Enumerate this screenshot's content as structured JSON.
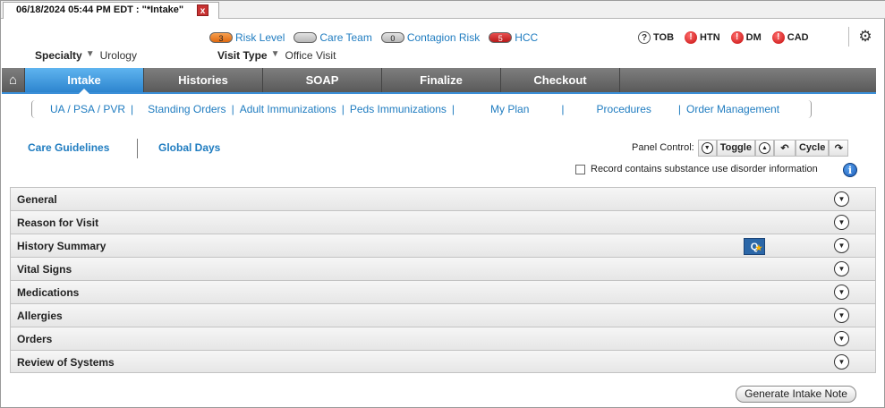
{
  "doc_tab": {
    "title": "06/18/2024 05:44 PM EDT : \"*Intake\"",
    "close": "x"
  },
  "badges": [
    {
      "count": "3",
      "label": "Risk Level",
      "style": "orange"
    },
    {
      "count": "",
      "label": "Care Team",
      "style": "gray"
    },
    {
      "count": "0",
      "label": "Contagion Risk",
      "style": "gray"
    },
    {
      "count": "5",
      "label": "HCC",
      "style": "red"
    }
  ],
  "indicators": [
    {
      "icon": "?",
      "label": "TOB",
      "kind": "question"
    },
    {
      "icon": "!",
      "label": "HTN",
      "kind": "alert"
    },
    {
      "icon": "!",
      "label": "DM",
      "kind": "alert"
    },
    {
      "icon": "!",
      "label": "CAD",
      "kind": "alert"
    }
  ],
  "meta": {
    "specialty_label": "Specialty",
    "specialty_value": "Urology",
    "visit_type_label": "Visit Type",
    "visit_type_value": "Office Visit",
    "caret": "▼"
  },
  "main_tabs": [
    "Intake",
    "Histories",
    "SOAP",
    "Finalize",
    "Checkout"
  ],
  "active_tab": "Intake",
  "subnav": [
    "UA / PSA / PVR",
    "Standing Orders",
    "Adult Immunizations",
    "Peds Immunizations",
    "My Plan",
    "Procedures",
    "Order Management"
  ],
  "guidelines": {
    "care_guidelines": "Care Guidelines",
    "global_days": "Global Days"
  },
  "panel_control": {
    "label": "Panel Control:",
    "toggle": "Toggle",
    "cycle": "Cycle"
  },
  "sud_checkbox": {
    "label": "Record contains substance use disorder information",
    "checked": false
  },
  "info_icon": "i",
  "panels": [
    "General",
    "Reason for Visit",
    "History Summary",
    "Vital Signs",
    "Medications",
    "Allergies",
    "Orders",
    "Review of Systems"
  ],
  "history_badge": {
    "letter": "Q",
    "star": "★"
  },
  "generate_button": "Generate Intake Note",
  "colors": {
    "accent": "#1f7cc0",
    "tab_active": "#3b8fd8",
    "tab_bar": "#6b6b6b"
  }
}
